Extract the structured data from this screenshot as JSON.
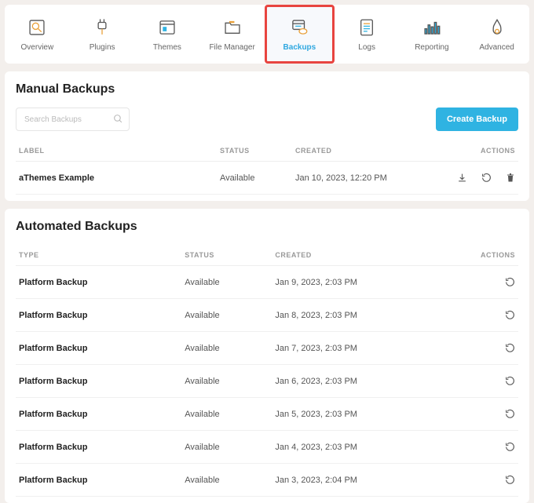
{
  "nav": {
    "items": [
      {
        "label": "Overview",
        "icon": "overview"
      },
      {
        "label": "Plugins",
        "icon": "plugins"
      },
      {
        "label": "Themes",
        "icon": "themes"
      },
      {
        "label": "File Manager",
        "icon": "filemanager"
      },
      {
        "label": "Backups",
        "icon": "backups"
      },
      {
        "label": "Logs",
        "icon": "logs"
      },
      {
        "label": "Reporting",
        "icon": "reporting"
      },
      {
        "label": "Advanced",
        "icon": "advanced"
      }
    ],
    "activeIndex": 4
  },
  "manual": {
    "title": "Manual Backups",
    "search_placeholder": "Search Backups",
    "create_label": "Create Backup",
    "columns": {
      "label": "LABEL",
      "status": "STATUS",
      "created": "CREATED",
      "actions": "ACTIONS"
    },
    "rows": [
      {
        "label": "aThemes Example",
        "status": "Available",
        "created": "Jan 10, 2023, 12:20 PM"
      }
    ]
  },
  "auto": {
    "title": "Automated Backups",
    "columns": {
      "type": "TYPE",
      "status": "STATUS",
      "created": "CREATED",
      "actions": "ACTIONS"
    },
    "rows": [
      {
        "type": "Platform Backup",
        "status": "Available",
        "created": "Jan 9, 2023, 2:03 PM"
      },
      {
        "type": "Platform Backup",
        "status": "Available",
        "created": "Jan 8, 2023, 2:03 PM"
      },
      {
        "type": "Platform Backup",
        "status": "Available",
        "created": "Jan 7, 2023, 2:03 PM"
      },
      {
        "type": "Platform Backup",
        "status": "Available",
        "created": "Jan 6, 2023, 2:03 PM"
      },
      {
        "type": "Platform Backup",
        "status": "Available",
        "created": "Jan 5, 2023, 2:03 PM"
      },
      {
        "type": "Platform Backup",
        "status": "Available",
        "created": "Jan 4, 2023, 2:03 PM"
      },
      {
        "type": "Platform Backup",
        "status": "Available",
        "created": "Jan 3, 2023, 2:04 PM"
      }
    ]
  },
  "colors": {
    "accent": "#2fb3e2",
    "highlight": "#e8443f",
    "orange": "#e9a13b"
  }
}
